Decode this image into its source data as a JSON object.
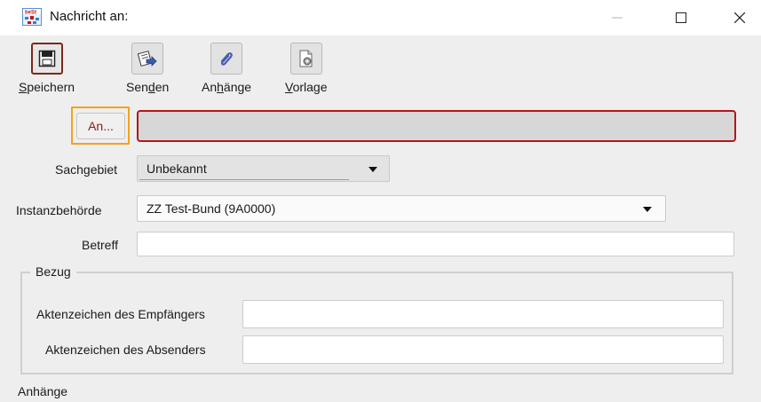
{
  "window": {
    "title": "Nachricht an:",
    "app_icon_text": "beSt"
  },
  "toolbar": {
    "items": [
      {
        "pre": "",
        "mnemonic": "S",
        "post": "peichern",
        "icon": "floppy-disk-icon"
      },
      {
        "pre": "Sen",
        "mnemonic": "d",
        "post": "en",
        "icon": "send-icon"
      },
      {
        "pre": "An",
        "mnemonic": "h",
        "post": "änge",
        "icon": "paperclip-icon"
      },
      {
        "pre": "",
        "mnemonic": "V",
        "post": "orlage",
        "icon": "template-gear-icon"
      }
    ]
  },
  "form": {
    "an_button": "An...",
    "an_value": "",
    "sachgebiet_label": "Sachgebiet",
    "sachgebiet_value": "Unbekannt",
    "instanz_label": "Instanzbehörde",
    "instanz_value": "ZZ Test-Bund (9A0000)",
    "betreff_label": "Betreff",
    "betreff_value": "",
    "bezug_title": "Bezug",
    "aktenzeichen_empfaenger_label": "Aktenzeichen des Empfängers",
    "aktenzeichen_empfaenger_value": "",
    "aktenzeichen_absender_label": "Aktenzeichen des Absenders",
    "aktenzeichen_absender_value": "",
    "anhaenge_label": "Anhänge"
  },
  "colors": {
    "accent_focus": "#f1a31b",
    "error_border": "#b3161b",
    "toolbar_bg": "#eeeeee"
  }
}
